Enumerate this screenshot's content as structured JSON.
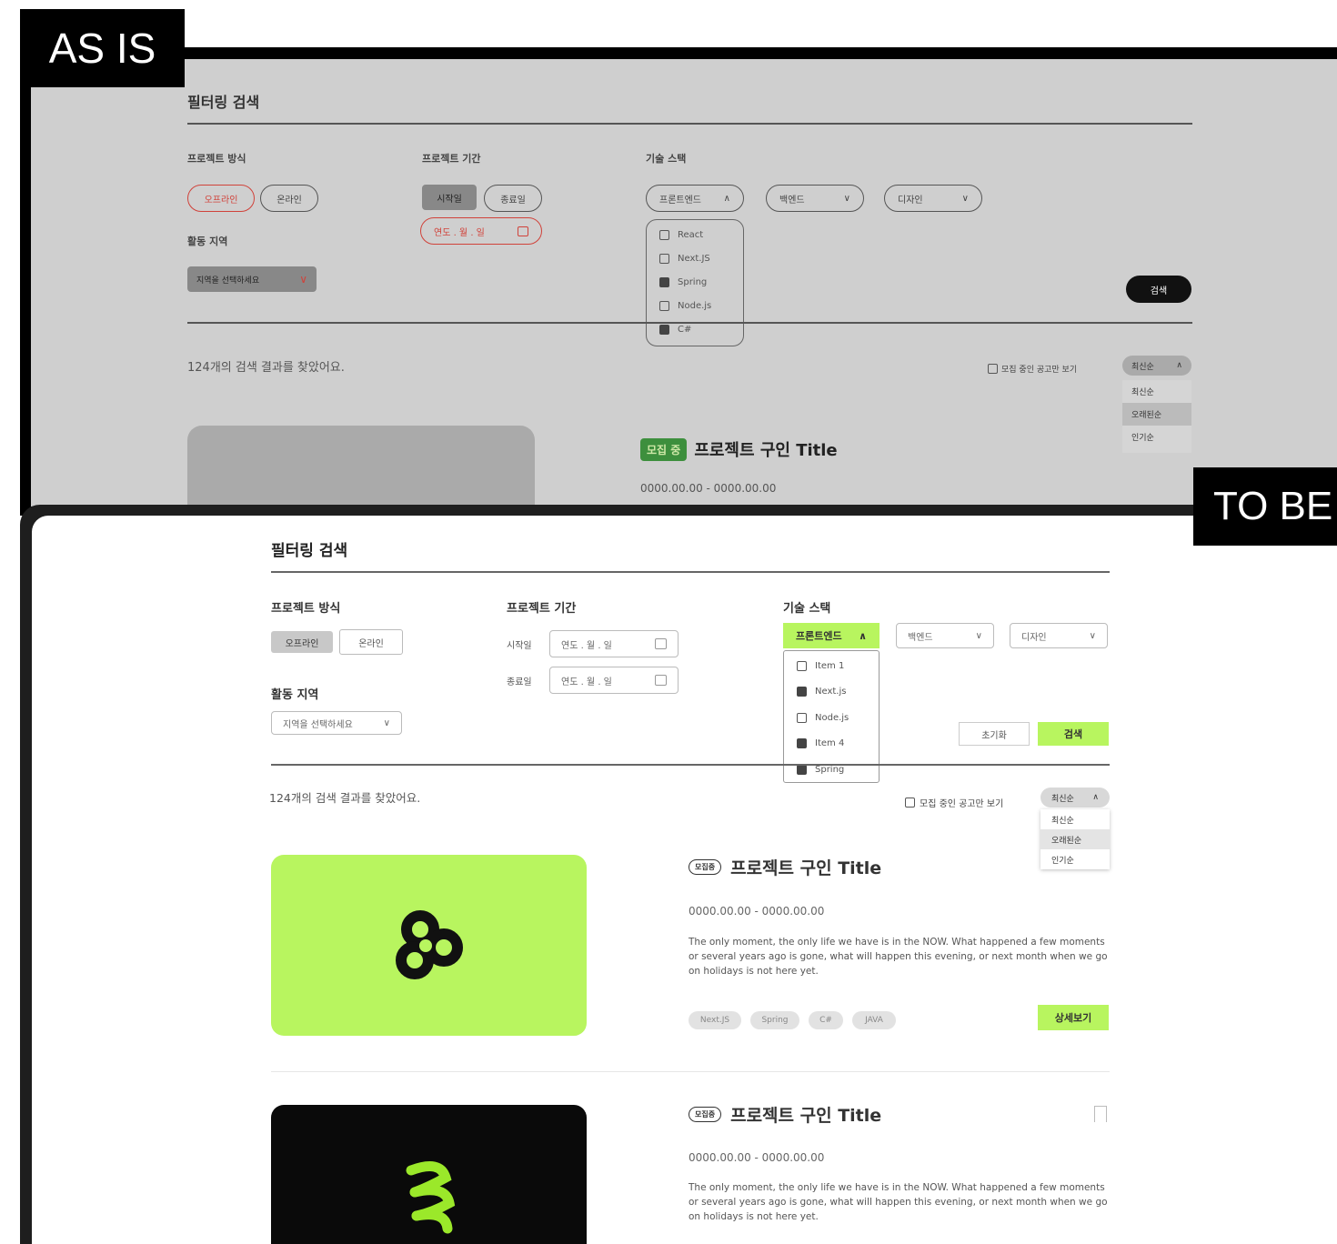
{
  "labels": {
    "asis": "AS IS",
    "tobe": "TO BE"
  },
  "asis": {
    "title": "필터링 검색",
    "method_label": "프로젝트 방식",
    "method_options": [
      "오프라인",
      "온라인"
    ],
    "period_label": "프로젝트 기간",
    "period_options": [
      "시작일",
      "종료일"
    ],
    "date_placeholder": "연도 . 월 . 일",
    "stack_label": "기술 스택",
    "stack_dropdowns": [
      "프론트엔드",
      "백엔드",
      "디자인"
    ],
    "stack_items": [
      {
        "label": "React",
        "checked": false
      },
      {
        "label": "Next.JS",
        "checked": false
      },
      {
        "label": "Spring",
        "checked": true
      },
      {
        "label": "Node.js",
        "checked": false
      },
      {
        "label": "C#",
        "checked": true
      }
    ],
    "region_label": "활동 지역",
    "region_placeholder": "지역을 선택하세요",
    "search_button": "검색",
    "result_text": "124개의 검색 결과를 찾았어요.",
    "recruit_only": "모집 중인 공고만 보기",
    "sort_selected": "최신순",
    "sort_options": [
      "최신순",
      "오래된순",
      "인기순"
    ],
    "card_badge": "모집 중",
    "card_title": "프로젝트 구인 Title",
    "card_date": "0000.00.00 - 0000.00.00"
  },
  "tobe": {
    "title": "필터링 검색",
    "method_label": "프로젝트 방식",
    "method_options": [
      "오프라인",
      "온라인"
    ],
    "period_label": "프로젝트 기간",
    "start_label": "시작일",
    "end_label": "종료일",
    "date_placeholder": "연도 . 월 . 일",
    "stack_label": "기술 스택",
    "stack_dropdowns": [
      "프론트엔드",
      "백엔드",
      "디자인"
    ],
    "stack_items": [
      {
        "label": "Item 1",
        "checked": false
      },
      {
        "label": "Next.js",
        "checked": true
      },
      {
        "label": "Node.js",
        "checked": false
      },
      {
        "label": "Item 4",
        "checked": true
      },
      {
        "label": "Spring",
        "checked": true
      }
    ],
    "region_label": "활동 지역",
    "region_placeholder": "지역을 선택하세요",
    "reset_button": "초기화",
    "search_button": "검색",
    "result_text": "124개의 검색 결과를 찾았어요.",
    "recruit_only": "모집 중인 공고만 보기",
    "sort_selected": "최신순",
    "sort_options": [
      "최신순",
      "오래된순",
      "인기순"
    ],
    "cards": [
      {
        "badge": "모집중",
        "title": "프로젝트 구인 Title",
        "date": "0000.00.00 - 0000.00.00",
        "desc": "The only moment, the only life we have is in the NOW. What happened a few moments or several years ago is gone, what will happen this evening, or next month when we go on holidays is not here yet.",
        "tags": [
          "Next.JS",
          "Spring",
          "C#",
          "JAVA"
        ],
        "detail_button": "상세보기"
      },
      {
        "badge": "모집중",
        "title": "프로젝트 구인 Title",
        "date": "0000.00.00 - 0000.00.00",
        "desc": "The only moment, the only life we have is in the NOW. What happened a few moments or several years ago is gone, what will happen this evening, or next month when we go on holidays is not here yet."
      }
    ]
  },
  "colors": {
    "accent_green": "#b8f55f",
    "as_is_red": "#d0423a",
    "as_is_bg": "#cfcfcf"
  }
}
